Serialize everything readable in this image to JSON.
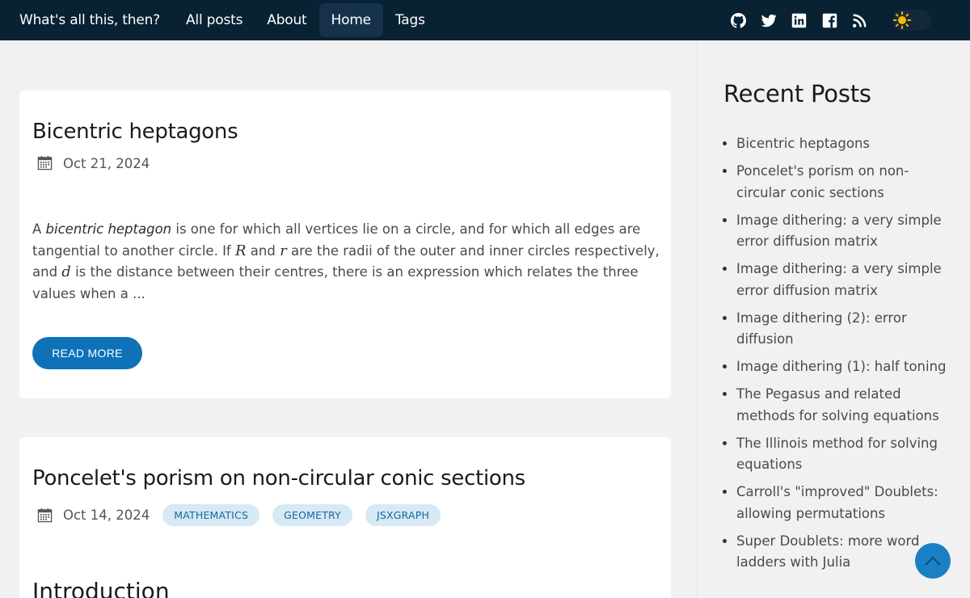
{
  "nav": {
    "brand": "What's all this, then?",
    "links": [
      "All posts",
      "About",
      "Home",
      "Tags"
    ],
    "active": "Home",
    "social_icons": [
      "github-icon",
      "twitter-icon",
      "linkedin-icon",
      "facebook-icon",
      "rss-icon"
    ],
    "theme_icon": "sun-icon"
  },
  "posts": [
    {
      "title": "Bicentric heptagons",
      "date": "Oct 21, 2024",
      "tags": [],
      "excerpt": {
        "p1": "A ",
        "em": "bicentric heptagon",
        "p2": " is one for which all vertices lie on a circle, and for which all edges are tangential to another circle. If ",
        "m1": "R",
        "p3": " and ",
        "m2": "r",
        "p4": " are the radii of the outer and inner circles respectively, and ",
        "m3": "d",
        "p5": " is the distance between their centres, there is an expression which relates the three values when a ..."
      },
      "read_more": "READ MORE"
    },
    {
      "title": "Poncelet's porism on non-circular conic sections",
      "date": "Oct 14, 2024",
      "tags": [
        "MATHEMATICS",
        "GEOMETRY",
        "JSXGRAPH"
      ],
      "section_heading": "Introduction"
    }
  ],
  "sidebar": {
    "title": "Recent Posts",
    "items": [
      "Bicentric heptagons",
      "Poncelet's porism on non-circular conic sections",
      "Image dithering: a very simple error diffusion matrix",
      "Image dithering: a very simple error diffusion matrix",
      "Image dithering (2): error diffusion",
      "Image dithering (1): half toning",
      "The Pegasus and related methods for solving equations",
      "The Illinois method for solving equations",
      "Carroll's \"improved\" Doublets: allowing permutations",
      "Super Doublets: more word ladders with Julia"
    ]
  },
  "colors": {
    "nav_bg": "#082133",
    "accent": "#0f72b8",
    "tag_bg": "#d6e9f4",
    "tag_text": "#1767a0",
    "page_bg": "#f1f1f1"
  },
  "scroll_top_icon": "chevron-up-icon"
}
